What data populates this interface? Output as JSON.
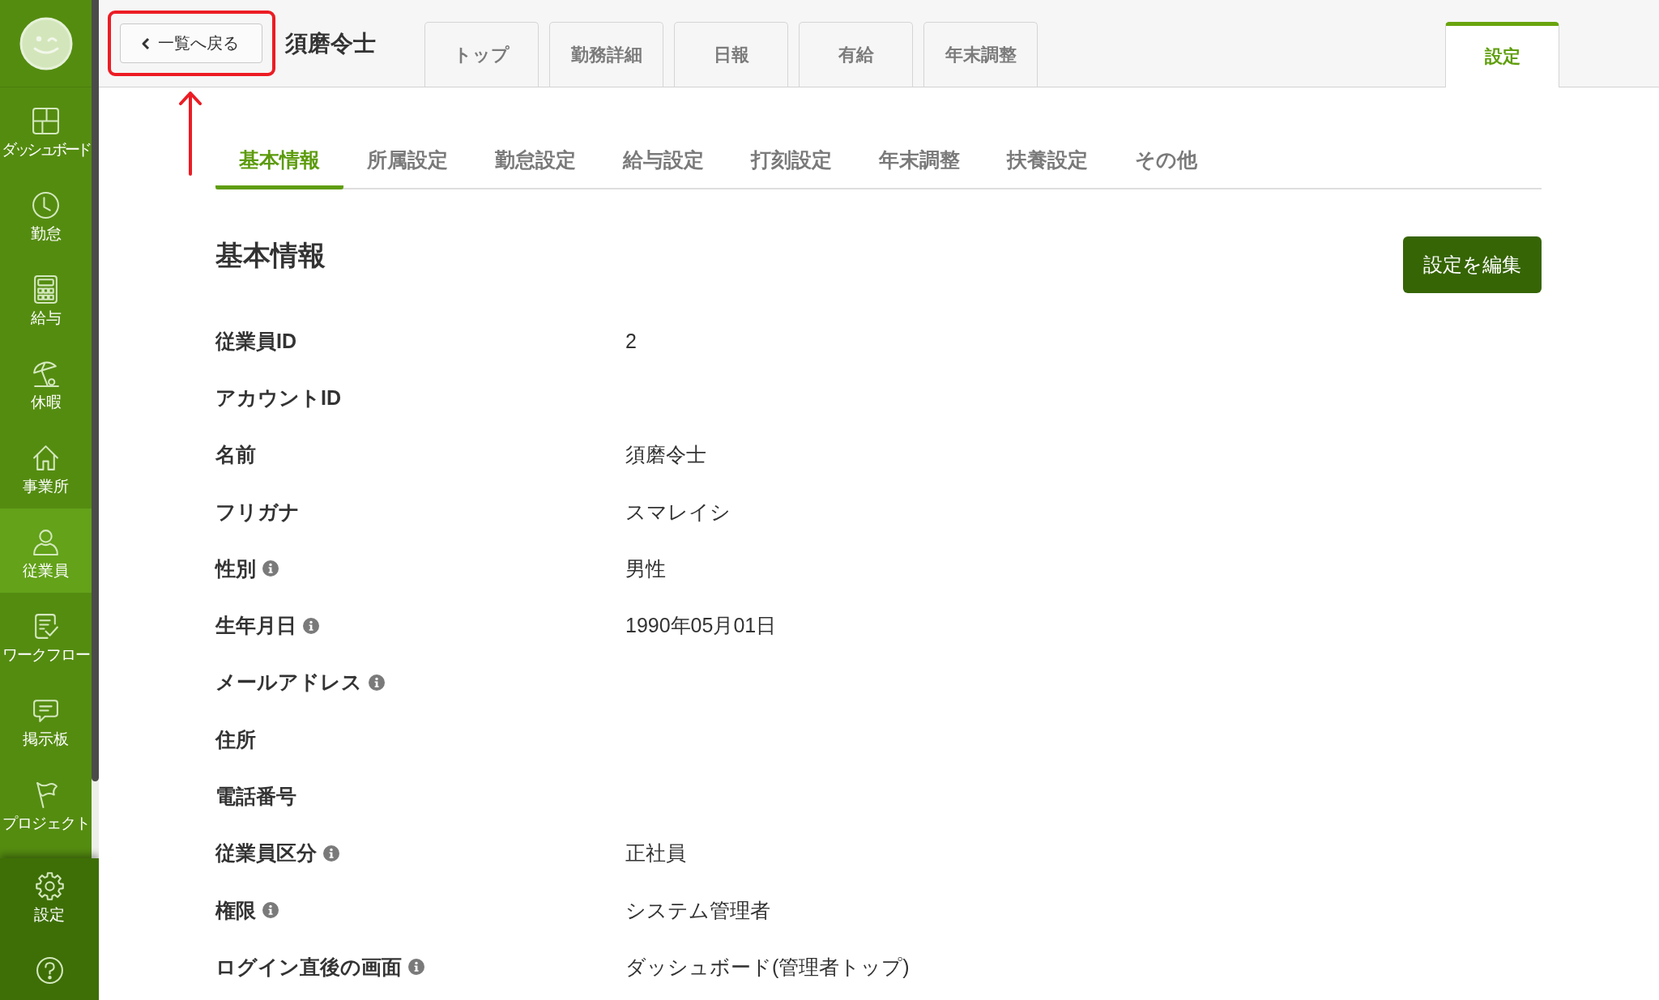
{
  "sidebar": {
    "items": [
      {
        "label": "ダッシュボード",
        "selected": false
      },
      {
        "label": "勤怠",
        "selected": false
      },
      {
        "label": "給与",
        "selected": false
      },
      {
        "label": "休暇",
        "selected": false
      },
      {
        "label": "事業所",
        "selected": false
      },
      {
        "label": "従業員",
        "selected": true
      },
      {
        "label": "ワークフロー",
        "selected": false
      },
      {
        "label": "掲示板",
        "selected": false
      },
      {
        "label": "プロジェクト",
        "selected": false
      }
    ],
    "footer_items": [
      {
        "label": "設定",
        "selected": false
      },
      {
        "selected": false
      }
    ]
  },
  "header": {
    "back_button": "一覧へ戻る",
    "employee_name": "須磨令士",
    "tabs": [
      {
        "label": "トップ",
        "selected": false
      },
      {
        "label": "勤務詳細",
        "selected": false
      },
      {
        "label": "日報",
        "selected": false
      },
      {
        "label": "有給",
        "selected": false
      },
      {
        "label": "年末調整",
        "selected": false
      },
      {
        "label": "設定",
        "selected": true
      }
    ]
  },
  "section_tabs": [
    {
      "label": "基本情報",
      "selected": true
    },
    {
      "label": "所属設定",
      "selected": false
    },
    {
      "label": "勤怠設定",
      "selected": false
    },
    {
      "label": "給与設定",
      "selected": false
    },
    {
      "label": "打刻設定",
      "selected": false
    },
    {
      "label": "年末調整",
      "selected": false
    },
    {
      "label": "扶養設定",
      "selected": false
    },
    {
      "label": "その他",
      "selected": false
    }
  ],
  "section": {
    "title": "基本情報",
    "edit_button": "設定を編集",
    "fields": [
      {
        "label": "従業員ID",
        "value": "2",
        "info": false
      },
      {
        "label": "アカウントID",
        "info": false
      },
      {
        "label": "名前",
        "value": "須磨令士",
        "info": false
      },
      {
        "label": "フリガナ",
        "value": "スマレイシ",
        "info": false
      },
      {
        "label": "性別",
        "value": "男性",
        "info": true
      },
      {
        "label": "生年月日",
        "value": "1990年05月01日",
        "info": true
      },
      {
        "label": "メールアドレス",
        "info": true
      },
      {
        "label": "住所",
        "info": false
      },
      {
        "label": "電話番号",
        "info": false
      },
      {
        "label": "従業員区分",
        "value": "正社員",
        "info": true
      },
      {
        "label": "権限",
        "value": "システム管理者",
        "info": true
      },
      {
        "label": "ログイン直後の画面",
        "value": "ダッシュボード(管理者トップ)",
        "info": true
      }
    ]
  }
}
